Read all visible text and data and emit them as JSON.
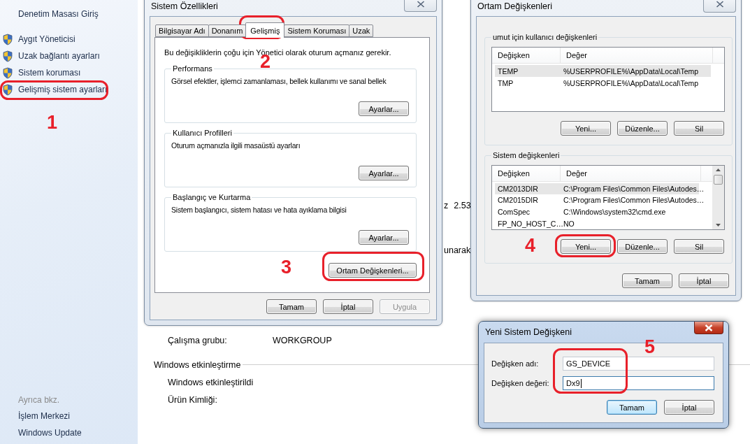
{
  "sidebar": {
    "home_link": "Denetim Masası Giriş",
    "tasks": [
      {
        "label": "Aygıt Yöneticisi"
      },
      {
        "label": "Uzak bağlantı ayarları"
      },
      {
        "label": "Sistem koruması"
      },
      {
        "label": "Gelişmiş sistem ayarları"
      }
    ],
    "see_also_heading": "Ayrıca bkz.",
    "see_also": [
      "İşlem Merkezi",
      "Windows Update"
    ]
  },
  "background": {
    "fragments": [
      {
        "texts": [
          "z",
          "2.53"
        ]
      },
      {
        "texts": [
          "unarak"
        ]
      }
    ],
    "workgroup": {
      "label": "Çalışma grubu:",
      "value": "WORKGROUP"
    },
    "activation": {
      "heading": "Windows etkinleştirme",
      "status": "Windows etkinleştirildi",
      "product_id_label": "Ürün Kimliği:"
    }
  },
  "system_properties": {
    "title": "Sistem Özellikleri",
    "active": false,
    "tabs": [
      {
        "label": "Bilgisayar Adı",
        "selected": false
      },
      {
        "label": "Donanım",
        "selected": false
      },
      {
        "label": "Gelişmiş",
        "selected": true
      },
      {
        "label": "Sistem Koruması",
        "selected": false
      },
      {
        "label": "Uzak",
        "selected": false
      }
    ],
    "note": "Bu değişikliklerin çoğu için Yönetici olarak oturum açmanız gerekir.",
    "groups": [
      {
        "title": "Performans",
        "description": "Görsel efektler, işlemci zamanlaması, bellek kullanımı ve sanal bellek",
        "button": "Ayarlar..."
      },
      {
        "title": "Kullanıcı Profilleri",
        "description": "Oturum açmanızla ilgili masaüstü ayarları",
        "button": "Ayarlar..."
      },
      {
        "title": "Başlangıç ve Kurtarma",
        "description": "Sistem başlangıcı, sistem hatası ve hata ayıklama bilgisi",
        "button": "Ayarlar..."
      }
    ],
    "env_button": "Ortam Değişkenleri...",
    "buttons": [
      {
        "label": "Tamam",
        "disabled": false
      },
      {
        "label": "İptal",
        "disabled": false
      },
      {
        "label": "Uygula",
        "disabled": true
      }
    ]
  },
  "environment_variables": {
    "title": "Ortam Değişkenleri",
    "active": false,
    "sections": [
      {
        "title": "umut için kullanıcı değişkenleri",
        "columns": [
          "Değişken",
          "Değer"
        ],
        "scrollable": false,
        "rows": [
          {
            "name": "TEMP",
            "value": "%USERPROFILE%\\AppData\\Local\\Temp",
            "selected": true
          },
          {
            "name": "TMP",
            "value": "%USERPROFILE%\\AppData\\Local\\Temp",
            "selected": false
          }
        ],
        "buttons": [
          "Yeni...",
          "Düzenle...",
          "Sil"
        ]
      },
      {
        "title": "Sistem değişkenleri",
        "columns": [
          "Değişken",
          "Değer"
        ],
        "scrollable": true,
        "rows": [
          {
            "name": "CM2013DIR",
            "value": "C:\\Program Files\\Common Files\\Autodes…",
            "selected": true
          },
          {
            "name": "CM2015DIR",
            "value": "C:\\Program Files\\Common Files\\Autodes…",
            "selected": false
          },
          {
            "name": "ComSpec",
            "value": "C:\\Windows\\system32\\cmd.exe",
            "selected": false
          },
          {
            "name": "FP_NO_HOST_C…",
            "value": "NO",
            "selected": false
          }
        ],
        "buttons": [
          "Yeni...",
          "Düzenle...",
          "Sil"
        ]
      }
    ],
    "buttons": [
      "Tamam",
      "İptal"
    ]
  },
  "new_variable": {
    "title": "Yeni Sistem Değişkeni",
    "active": true,
    "fields": [
      {
        "label": "Değişken adı:",
        "value": "GS_DEVICE",
        "focused": false
      },
      {
        "label": "Değişken değeri:",
        "value": "Dx9",
        "focused": true
      }
    ],
    "buttons": [
      {
        "label": "Tamam",
        "default": true
      },
      {
        "label": "İptal",
        "default": false
      }
    ]
  },
  "annotations": [
    {
      "number": "1"
    },
    {
      "number": "2"
    },
    {
      "number": "3"
    },
    {
      "number": "4"
    },
    {
      "number": "5"
    }
  ]
}
